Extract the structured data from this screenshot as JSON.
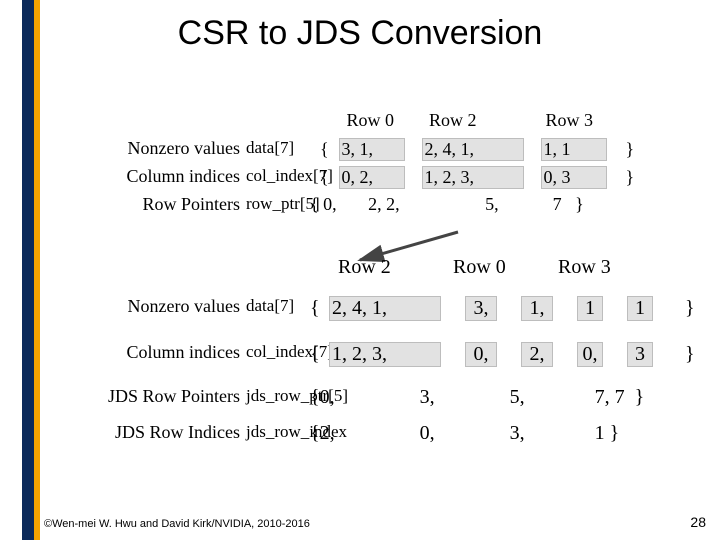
{
  "title": "CSR to JDS Conversion",
  "top": {
    "header": {
      "r0": "Row 0",
      "r2": "Row 2",
      "r3": "Row 3"
    },
    "labels": {
      "nzv": "Nonzero values",
      "nzv_arr": "data[7]",
      "col": "Column indices",
      "col_arr": "col_index[7]",
      "ptr": "Row Pointers",
      "ptr_arr": "row_ptr[5]"
    },
    "data": {
      "open": "{",
      "r0": "3,  1,",
      "r2": "2,  4,  1,",
      "r3": "1,  1",
      "close": "}"
    },
    "colidx": {
      "open": "{",
      "r0": "0,  2,",
      "r2": "1,  2,  3,",
      "r3": "0,  3",
      "close": "}"
    },
    "rowptr": "{ 0,       2, 2,                   5,            7   }"
  },
  "bottom": {
    "header": {
      "r2": "Row 2",
      "r0": "Row 0",
      "r3": "Row 3"
    },
    "labels": {
      "nzv": "Nonzero values",
      "nzv_arr": "data[7]",
      "col": "Column indices",
      "col_arr": "col_index[7]",
      "jdsptr": "JDS Row Pointers",
      "jdsptr_arr": "jds_row_ptr[5]",
      "jdsidx": "JDS Row Indices",
      "jdsidx_arr": "jds_row_index"
    },
    "data": {
      "open": "{",
      "r2": "2,   4,   1,",
      "r0a": "3,",
      "r0b": "1,",
      "r3a": "1",
      "r3b": "1",
      "close": "}"
    },
    "colidx": {
      "open": "{",
      "r2": "1,   2,   3,",
      "r0a": "0,",
      "r0b": "2,",
      "r3a": "0,",
      "r3b": "3",
      "close": "}"
    },
    "jdsptr": "{0,                 3,               5,              7, 7  }",
    "jdsidx": "{2,                 0,               3,              1 }"
  },
  "footer": "©Wen-mei W. Hwu and David Kirk/NVIDIA, 2010-2016",
  "slidenum": "28"
}
